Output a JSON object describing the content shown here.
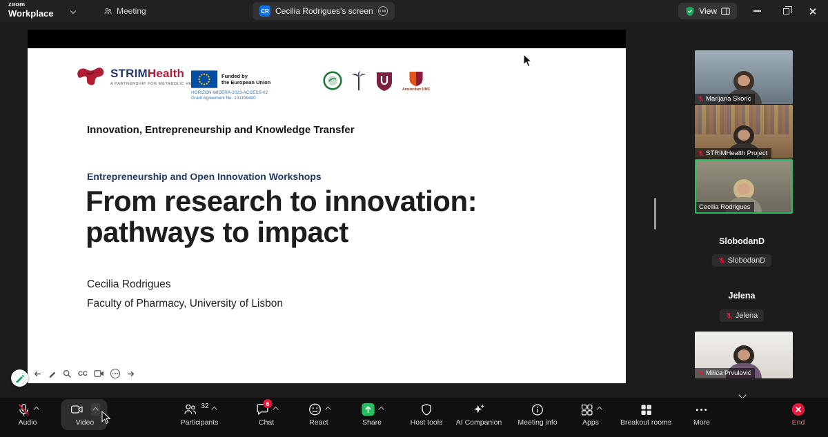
{
  "colors": {
    "zoom_blue": "#0E72ED",
    "accent_green": "#23BF61",
    "danger_red": "#E8173D",
    "shield_green": "#1EA55A",
    "eu_flag_blue": "#034EA2",
    "eu_text_blue": "#2E74B5",
    "slide_subheading_blue": "#1F3864",
    "strim_red": "#B01E36",
    "active_speaker_border": "#23BF61"
  },
  "titlebar": {
    "brand_top": "zoom",
    "brand_bottom": "Workplace",
    "meeting_tab_label": "Meeting",
    "screen_tab_label": "Cecilia Rodrigues's screen",
    "screen_tab_badge": "CR",
    "view_label": "View"
  },
  "slide": {
    "logo_part1": "STRIM",
    "logo_part2": "Health",
    "logo_tagline": "A PARTNERSHIP FOR METABOLIC HEALTH",
    "eu_funded_line1": "Funded by",
    "eu_funded_line2": "the European Union",
    "eu_program": "HORIZON-WIDERA-2023-ACCESS-02",
    "eu_grant": "Grant Agreement No. 101159400",
    "partner_amsterdam": "Amsterdam UMC",
    "heading": "Innovation, Entrepreneurship and Knowledge Transfer",
    "subheading": "Entrepreneurship and Open Innovation Workshops",
    "title_line1": "From research to innovation:",
    "title_line2": "pathways to impact",
    "author": "Cecilia Rodrigues",
    "affiliation": "Faculty of Pharmacy, University of Lisbon"
  },
  "annotation": {
    "cc_label": "CC"
  },
  "participants": {
    "tiles": [
      {
        "name": "Marijana Skoric"
      },
      {
        "name": "STRIMHealth Project"
      },
      {
        "name": "Cecilia Rodrigues"
      },
      {
        "name": "Milica Prvulović"
      }
    ],
    "audio_only": [
      {
        "header": "SlobodanD",
        "label": "SlobodanD"
      },
      {
        "header": "Jelena",
        "label": "Jelena"
      }
    ]
  },
  "toolbar": {
    "audio_label": "Audio",
    "video_label": "Video",
    "participants_label": "Participants",
    "participants_count": "32",
    "chat_label": "Chat",
    "chat_badge": "6",
    "react_label": "React",
    "share_label": "Share",
    "host_tools_label": "Host tools",
    "ai_companion_label": "AI Companion",
    "meeting_info_label": "Meeting info",
    "apps_label": "Apps",
    "breakout_label": "Breakout rooms",
    "more_label": "More",
    "end_label": "End"
  }
}
